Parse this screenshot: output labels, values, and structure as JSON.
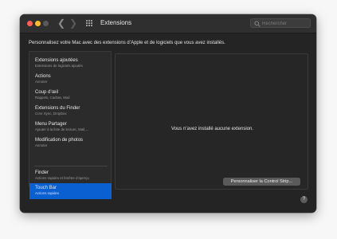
{
  "window": {
    "title": "Extensions",
    "nav": {
      "back_icon": "chevron-left-icon",
      "forward_icon": "chevron-right-icon",
      "grid_icon": "grid-icon"
    },
    "search": {
      "placeholder": "Rechercher",
      "value": ""
    }
  },
  "description": "Personnalisez votre Mac avec des extensions d’Apple et de logiciels que vous avez installés.",
  "sidebar": {
    "items": [
      {
        "title": "Extensions ajoutées",
        "subtitle": "Extensions de logiciels ajoutés"
      },
      {
        "title": "Actions",
        "subtitle": "Annoter"
      },
      {
        "title": "Coup d’œil",
        "subtitle": "Rappels, Cadran, Mail"
      },
      {
        "title": "Extensions du Finder",
        "subtitle": "Core Sync, Dropbox"
      },
      {
        "title": "Menu Partager",
        "subtitle": "Ajouter à la liste de lecture, Mail,..."
      },
      {
        "title": "Modification de photos",
        "subtitle": "Annoter"
      },
      {
        "title": "Finder",
        "subtitle": "Actions rapides et fenêtre d’aperçu"
      },
      {
        "title": "Touch Bar",
        "subtitle": "Actions rapides"
      }
    ],
    "selected": "Touch Bar"
  },
  "main": {
    "empty_message": "Vous n’avez installé aucune extension.",
    "button_label": "Personnaliser la Control Strip..."
  },
  "help_label": "?",
  "colors": {
    "accent": "#0a5fd1",
    "window_bg": "#242424",
    "panel_bg": "#262626"
  }
}
